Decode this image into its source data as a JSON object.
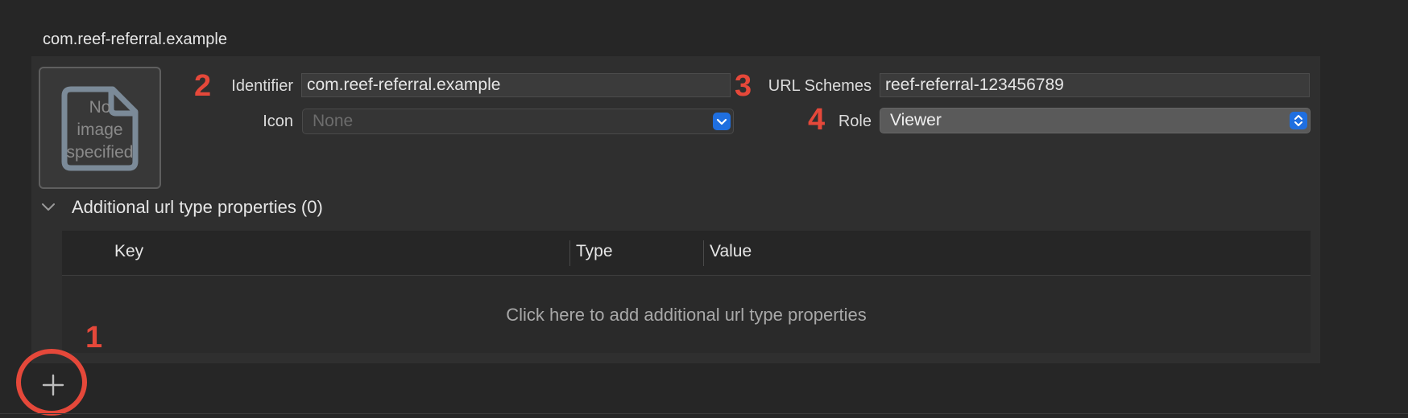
{
  "section": {
    "title": "com.reef-referral.example"
  },
  "image_well": {
    "placeholder": "No image specified",
    "lines": [
      "No",
      "image",
      "specified"
    ]
  },
  "badges": {
    "add": "1",
    "identifier": "2",
    "url_schemes": "3",
    "role": "4"
  },
  "identifier": {
    "label": "Identifier",
    "value": "com.reef-referral.example"
  },
  "icon": {
    "label": "Icon",
    "value": "None"
  },
  "url_schemes": {
    "label": "URL Schemes",
    "value": "reef-referral-123456789"
  },
  "role": {
    "label": "Role",
    "value": "Viewer"
  },
  "additional": {
    "title": "Additional url type properties (0)",
    "columns": [
      "Key",
      "Type",
      "Value"
    ],
    "empty_hint": "Click here to add additional url type properties"
  },
  "colors": {
    "annotation": "#e5483a",
    "accent": "#1f6fe0"
  },
  "icons": {
    "image_placeholder": "document-icon",
    "disclosure": "chevron-down-icon",
    "add": "plus-icon"
  }
}
